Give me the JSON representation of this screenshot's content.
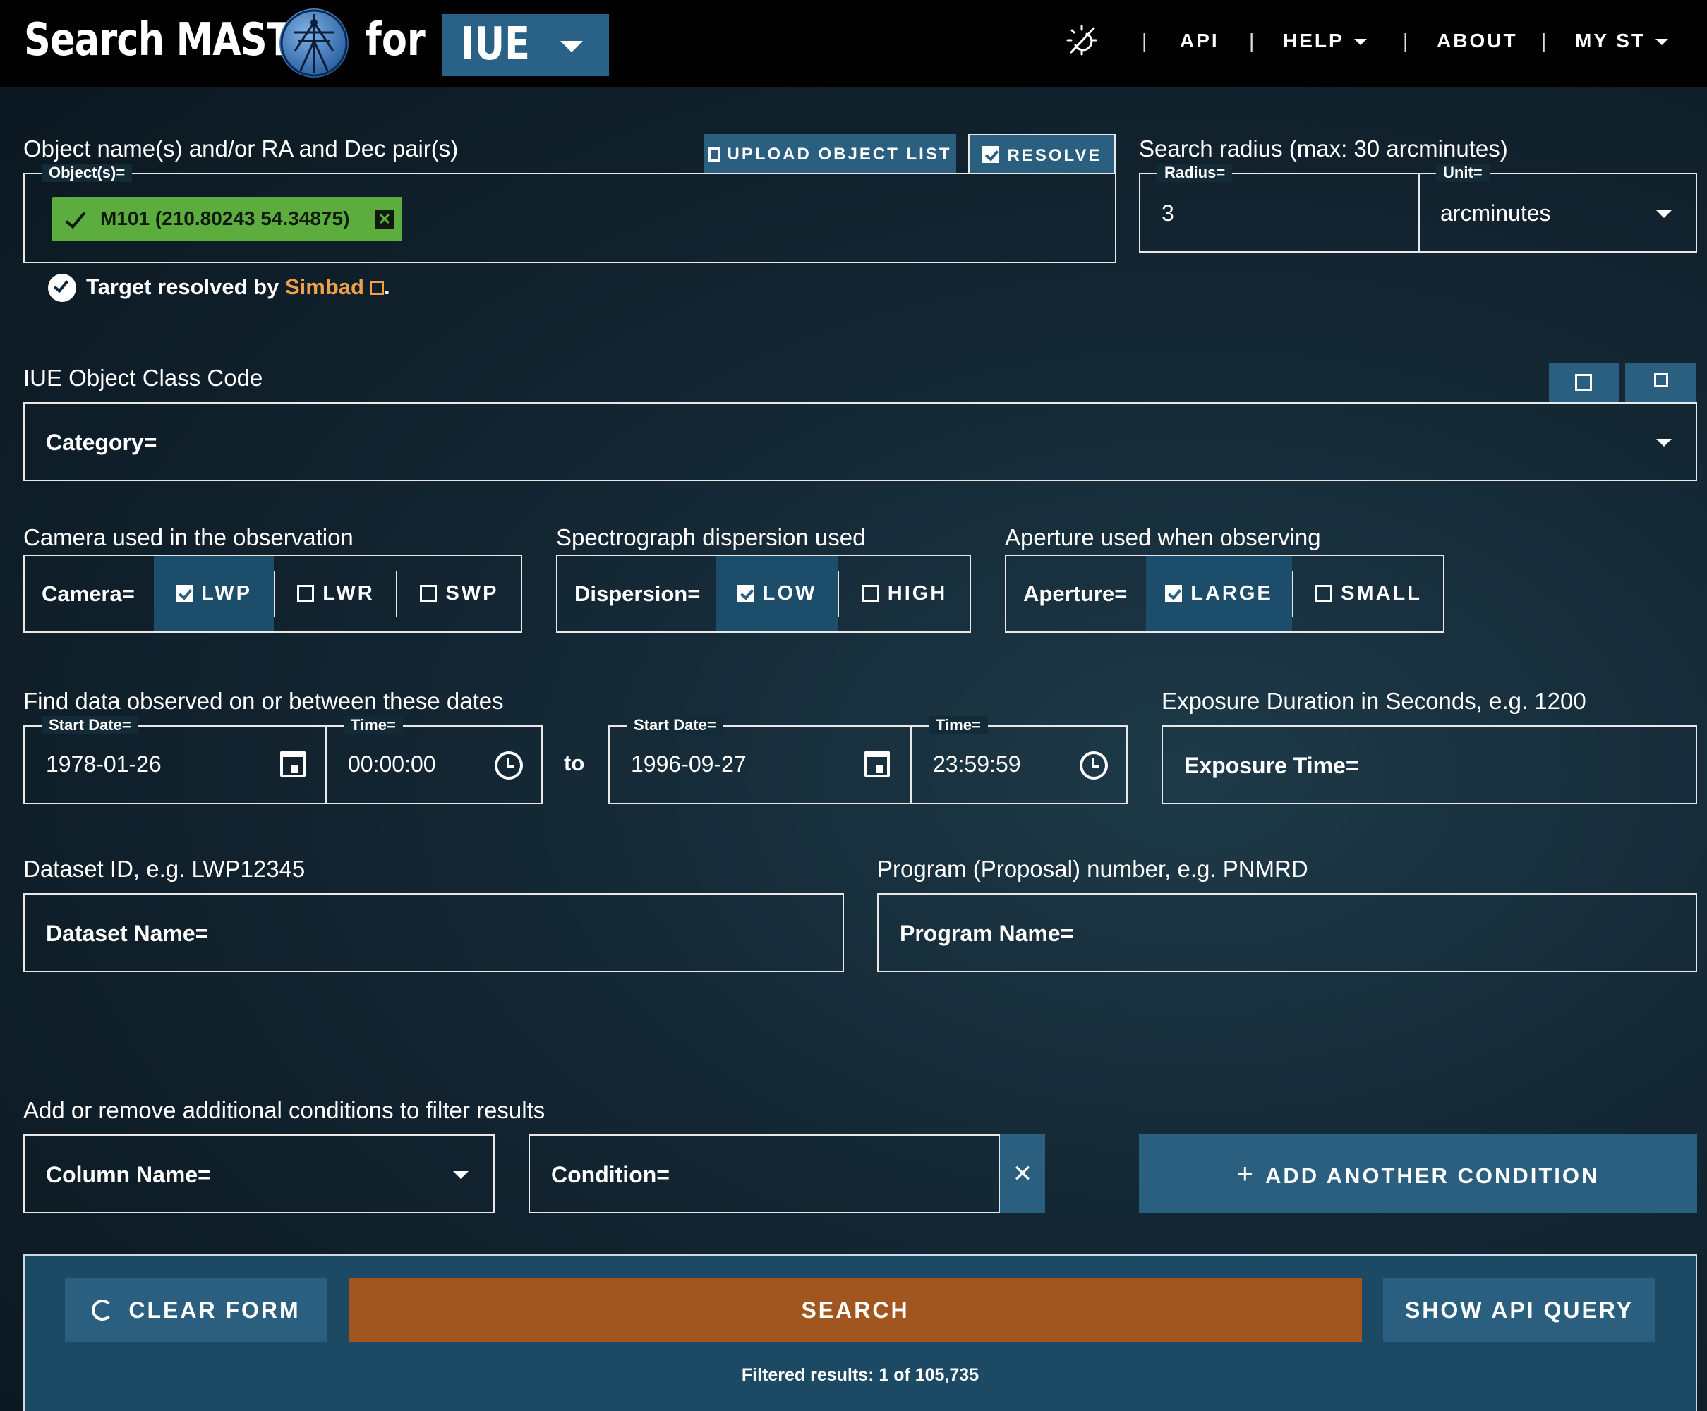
{
  "header": {
    "brand": "Search MAST",
    "for_word": "for",
    "mission": "IUE",
    "nav": {
      "api": "API",
      "help": "HELP",
      "about": "ABOUT",
      "my_st": "MY ST",
      "separator": "|"
    }
  },
  "object": {
    "label": "Object name(s) and/or RA and Dec pair(s)",
    "upload_label": "UPLOAD OBJECT LIST",
    "resolve_label": "RESOLVE",
    "legend": "Object(s)=",
    "chip": "M101 (210.80243 54.34875)",
    "resolved_prefix": "Target resolved by ",
    "resolved_link": "Simbad",
    "resolved_suffix": "."
  },
  "radius": {
    "label": "Search radius (max: 30 arcminutes)",
    "radius_legend": "Radius=",
    "radius_value": "3",
    "unit_legend": "Unit=",
    "unit_value": "arcminutes"
  },
  "class_code": {
    "label": "IUE Object Class Code",
    "placeholder": "Category="
  },
  "camera": {
    "label": "Camera used in the observation",
    "lead": "Camera=",
    "options": [
      {
        "label": "LWP",
        "checked": true
      },
      {
        "label": "LWR",
        "checked": false
      },
      {
        "label": "SWP",
        "checked": false
      }
    ]
  },
  "dispersion": {
    "label": "Spectrograph dispersion used",
    "lead": "Dispersion=",
    "options": [
      {
        "label": "LOW",
        "checked": true
      },
      {
        "label": "HIGH",
        "checked": false
      }
    ]
  },
  "aperture": {
    "label": "Aperture used when observing",
    "lead": "Aperture=",
    "options": [
      {
        "label": "LARGE",
        "checked": true
      },
      {
        "label": "SMALL",
        "checked": false
      }
    ]
  },
  "dates": {
    "label": "Find data observed on or between these dates",
    "start_legend": "Start Date=",
    "start_date": "1978-01-26",
    "start_time_legend": "Time=",
    "start_time": "00:00:00",
    "to_word": "to",
    "end_legend": "Start Date=",
    "end_date": "1996-09-27",
    "end_time_legend": "Time=",
    "end_time": "23:59:59"
  },
  "exposure": {
    "label": "Exposure Duration in Seconds, e.g. 1200",
    "placeholder": "Exposure Time="
  },
  "dataset": {
    "label": "Dataset ID, e.g. LWP12345",
    "placeholder": "Dataset Name="
  },
  "program": {
    "label": "Program (Proposal) number, e.g. PNMRD",
    "placeholder": "Program Name="
  },
  "conditions": {
    "label": "Add or remove additional conditions to filter results",
    "column_placeholder": "Column Name=",
    "condition_placeholder": "Condition=",
    "add_label": "ADD ANOTHER CONDITION"
  },
  "footer": {
    "clear_label": "CLEAR FORM",
    "search_label": "SEARCH",
    "api_label": "SHOW API QUERY",
    "results_text": "Filtered results: 1 of 105,735"
  },
  "colors": {
    "header_bg": "#000000",
    "accent_blue": "#2a5f80",
    "search_orange": "#a0561e",
    "chip_green": "#5cac3e",
    "link_orange": "#f0a04b"
  }
}
